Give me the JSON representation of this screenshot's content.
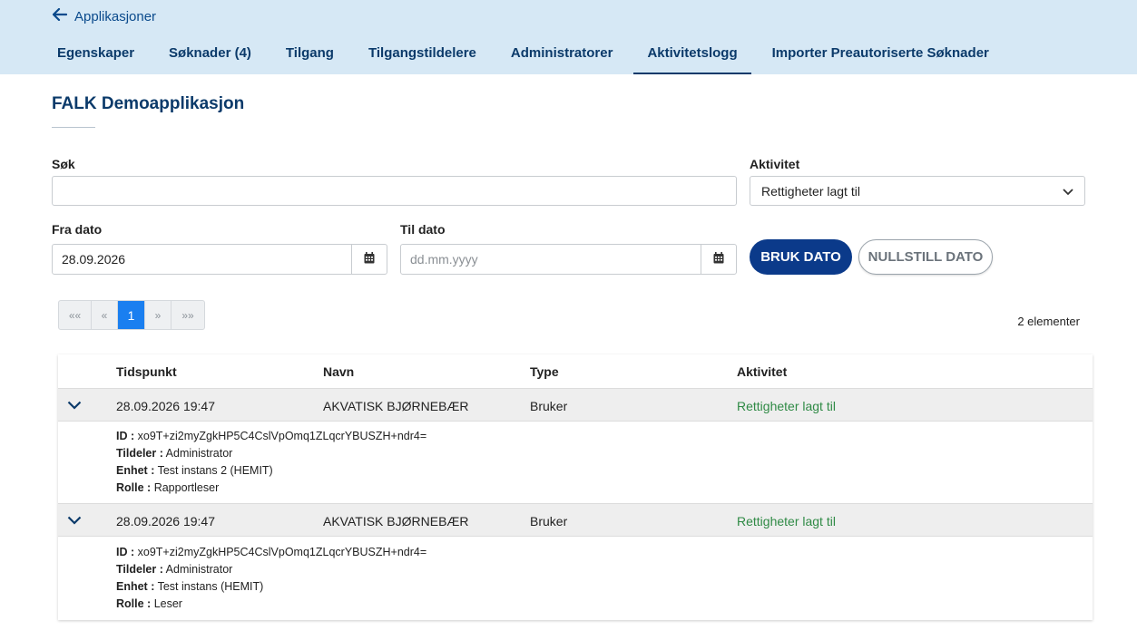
{
  "header": {
    "back_label": "Applikasjoner",
    "tabs": [
      {
        "label": "Egenskaper"
      },
      {
        "label": "Søknader (4)"
      },
      {
        "label": "Tilgang"
      },
      {
        "label": "Tilgangstildelere"
      },
      {
        "label": "Administratorer"
      },
      {
        "label": "Aktivitetslogg",
        "active": true
      },
      {
        "label": "Importer Preautoriserte Søknader"
      }
    ]
  },
  "page_title": "FALK Demoapplikasjon",
  "filters": {
    "search_label": "Søk",
    "search_value": "",
    "activity_label": "Aktivitet",
    "activity_selected": "Rettigheter lagt til",
    "from_label": "Fra dato",
    "from_value": "28.09.2026",
    "to_label": "Til dato",
    "to_placeholder": "dd.mm.yyyy",
    "apply_button": "BRUK DATO",
    "reset_button": "NULLSTILL DATO"
  },
  "pagination": {
    "first": "««",
    "prev": "«",
    "current": "1",
    "next": "»",
    "last": "»»",
    "count_text": "2 elementer"
  },
  "table": {
    "headers": {
      "time": "Tidspunkt",
      "name": "Navn",
      "type": "Type",
      "activity": "Aktivitet"
    },
    "rows": [
      {
        "time": "28.09.2026 19:47",
        "name": "AKVATISK BJØRNEBÆR",
        "type": "Bruker",
        "activity": "Rettigheter lagt til",
        "details": {
          "id_label": "ID :",
          "id": "xo9T+zi2myZgkHP5C4CslVpOmq1ZLqcrYBUSZH+ndr4=",
          "granter_label": "Tildeler :",
          "granter": "Administrator",
          "unit_label": "Enhet :",
          "unit": "Test instans 2 (HEMIT)",
          "role_label": "Rolle :",
          "role": "Rapportleser"
        }
      },
      {
        "time": "28.09.2026 19:47",
        "name": "AKVATISK BJØRNEBÆR",
        "type": "Bruker",
        "activity": "Rettigheter lagt til",
        "details": {
          "id_label": "ID :",
          "id": "xo9T+zi2myZgkHP5C4CslVpOmq1ZLqcrYBUSZH+ndr4=",
          "granter_label": "Tildeler :",
          "granter": "Administrator",
          "unit_label": "Enhet :",
          "unit": "Test instans (HEMIT)",
          "role_label": "Rolle :",
          "role": "Leser"
        }
      }
    ]
  },
  "colors": {
    "header_bg": "#d6e8f5",
    "primary": "#0b3a8a",
    "activity_green": "#2f8a45",
    "page_active": "#1a7ff0"
  }
}
